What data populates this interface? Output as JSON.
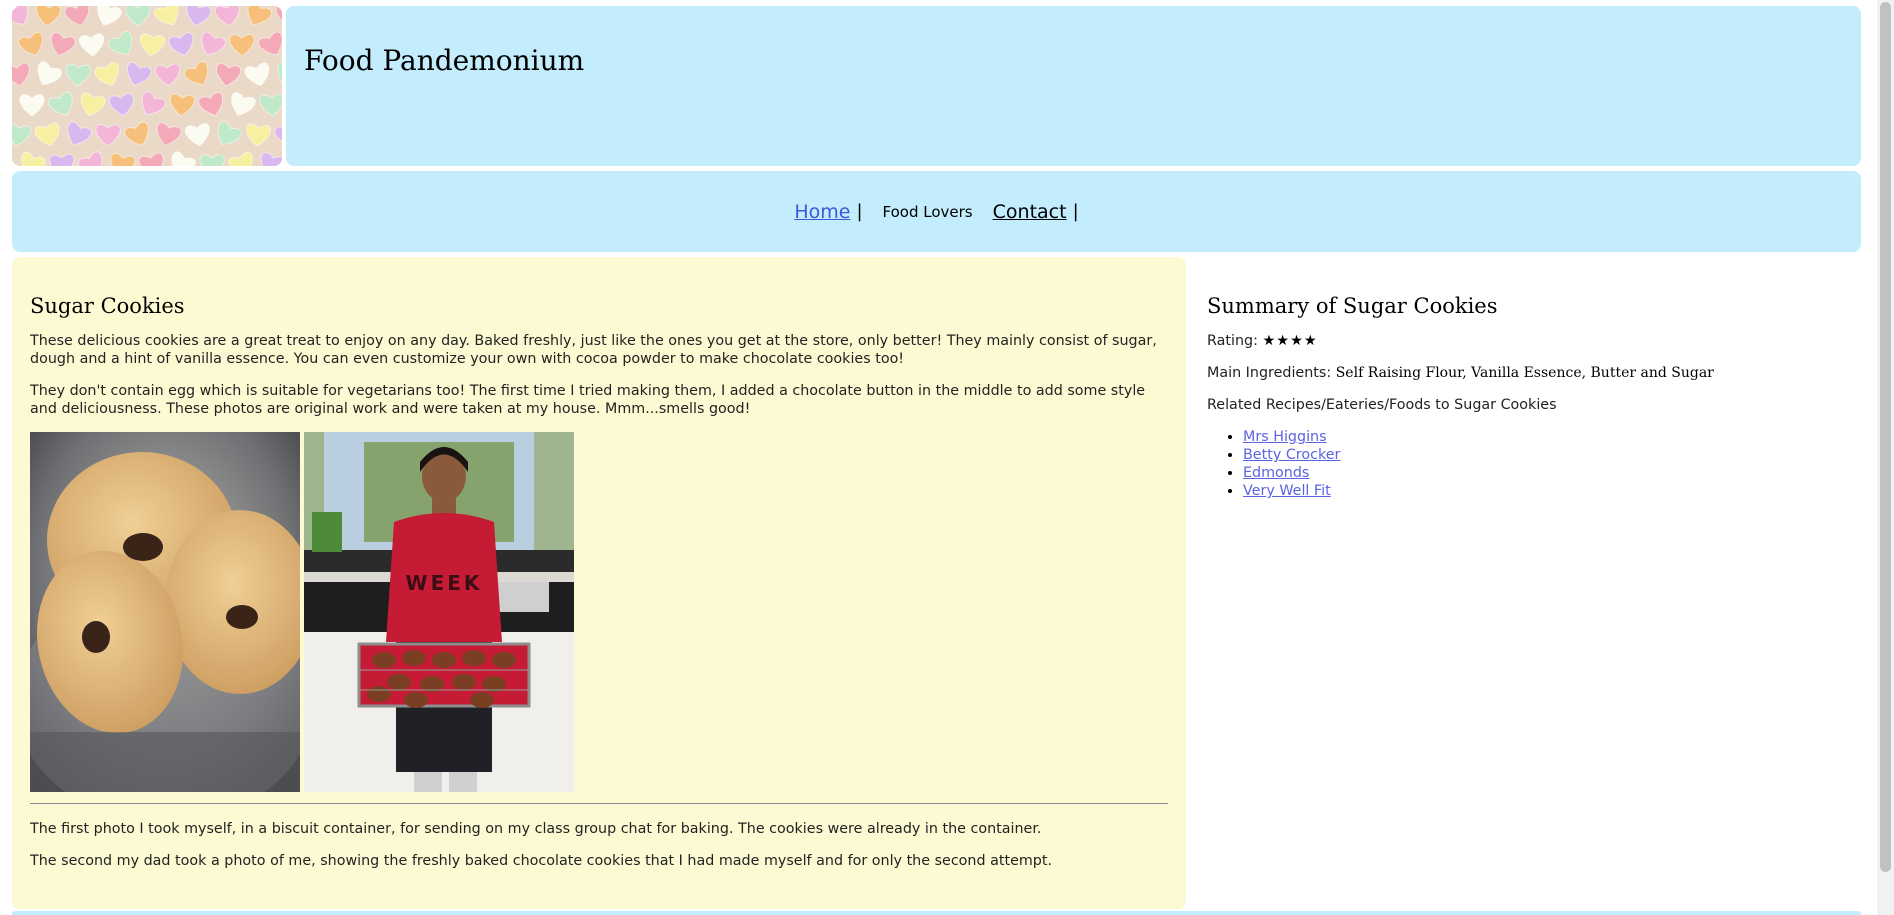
{
  "header": {
    "site_title": "Food Pandemonium"
  },
  "nav": {
    "home": "Home",
    "separator": "|",
    "food_lovers": "Food Lovers",
    "contact": "Contact"
  },
  "main": {
    "title": "Sugar Cookies",
    "paragraphs": [
      "These delicious cookies are a great treat to enjoy on any day. Baked freshly, just like the ones you get at the store, only better! They mainly consist of sugar, dough and a hint of vanilla essence. You can even customize your own with cocoa powder to make chocolate cookies too!",
      "They don't contain egg which is suitable for vegetarians too! The first time I tried making them, I added a chocolate button in the middle to add some style and deliciousness. These photos are original work and were taken at my house. Mmm...smells good!"
    ],
    "photo_shirt_text": "WEEK",
    "captions": [
      "The first photo I took myself, in a biscuit container, for sending on my class group chat for baking. The cookies were already in the container.",
      "The second my dad took a photo of me, showing the freshly baked chocolate cookies that I had made myself and for only the second attempt."
    ]
  },
  "sidebar": {
    "title": "Summary of Sugar Cookies",
    "rating_label": "Rating:",
    "rating_stars": "★★★★",
    "ingredients_label": "Main Ingredients:",
    "ingredients_value": "Self Raising Flour, Vanilla Essence, Butter and Sugar",
    "related_label": "Related Recipes/Eateries/Foods to Sugar Cookies",
    "related_links": [
      "Mrs Higgins",
      "Betty Crocker",
      "Edmonds",
      "Very Well Fit"
    ]
  }
}
